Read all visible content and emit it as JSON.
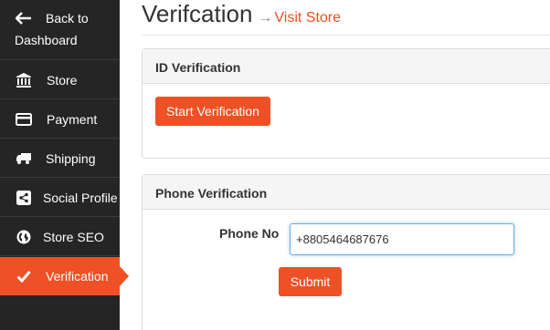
{
  "sidebar": {
    "back": {
      "line1": "Back to",
      "line2": "Dashboard"
    },
    "items": [
      {
        "label": "Store"
      },
      {
        "label": "Payment"
      },
      {
        "label": "Shipping"
      },
      {
        "label": "Social Profile"
      },
      {
        "label": "Store SEO"
      },
      {
        "label": "Verification"
      }
    ],
    "active_color": "#f05025",
    "background": "#252525"
  },
  "header": {
    "title": "Verifcation",
    "arrow": "→",
    "visit_link": "Visit Store"
  },
  "id_verification": {
    "heading": "ID Verification",
    "start_button": "Start Verification"
  },
  "phone_verification": {
    "heading": "Phone Verification",
    "phone_label": "Phone No",
    "phone_value": "+8805464687676",
    "submit_button": "Submit"
  }
}
